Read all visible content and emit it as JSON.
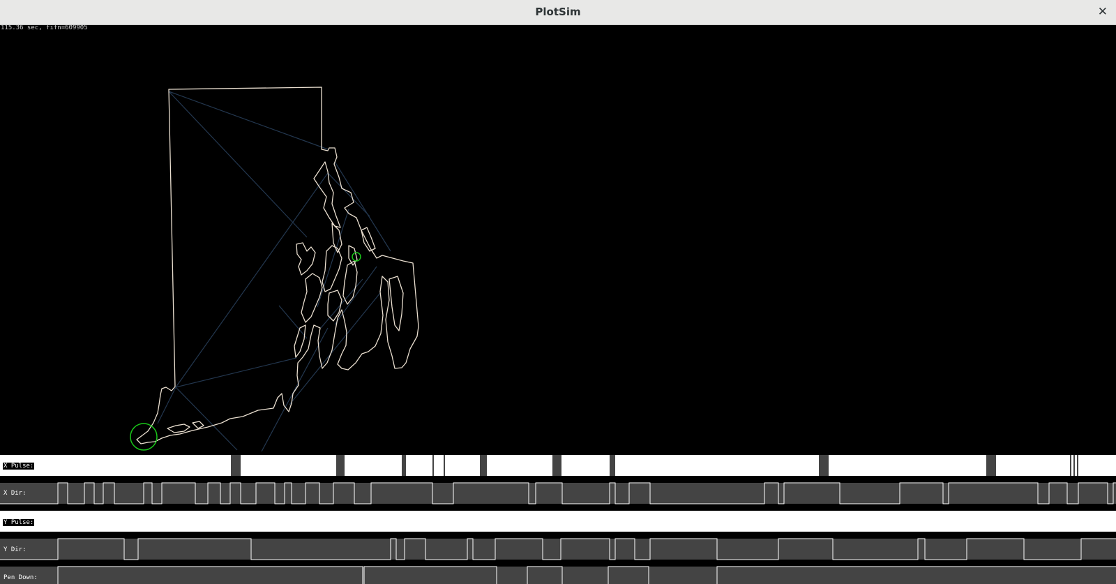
{
  "window": {
    "title": "PlotSim",
    "close_icon": "close-icon"
  },
  "status": {
    "text": "115.36 sec, fifn=609905"
  },
  "colors": {
    "outline": "#eadfd0",
    "travel": "#23374f",
    "marker": "#19c619",
    "signal_high": "#ffffff",
    "signal_low": "#444444"
  },
  "channels": [
    {
      "id": "x_pulse",
      "label": "X Pulse:"
    },
    {
      "id": "x_dir",
      "label": "X Dir:"
    },
    {
      "id": "y_pulse",
      "label": "Y Pulse:"
    },
    {
      "id": "y_dir",
      "label": "Y Dir:"
    },
    {
      "id": "pen_down",
      "label": "Pen Down:"
    }
  ]
}
